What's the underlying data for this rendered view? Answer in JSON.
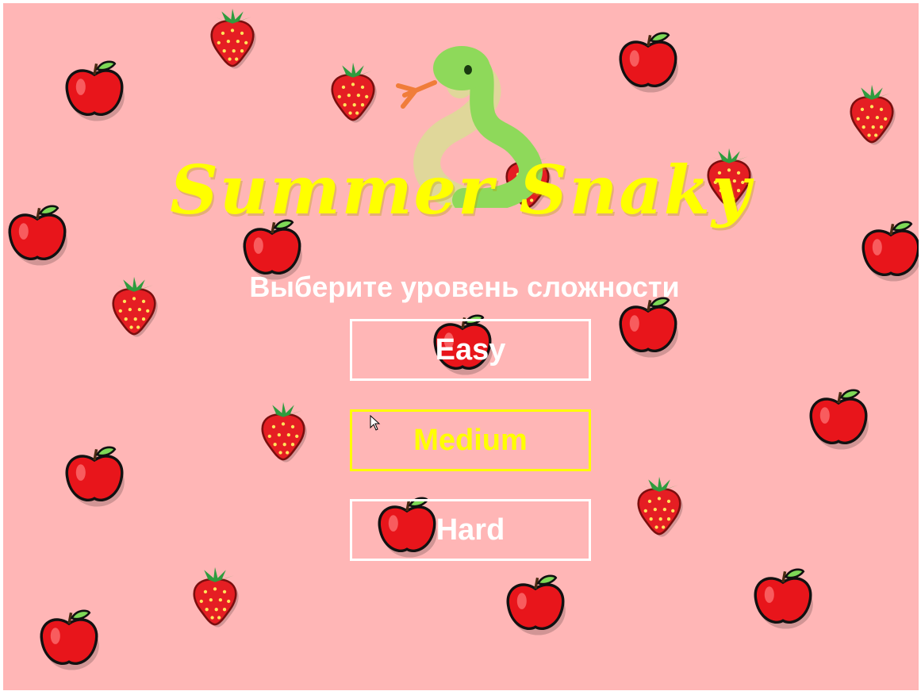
{
  "title": "Summer Snaky",
  "subtitle": "Выберите уровень сложности",
  "buttons": {
    "easy": "Easy",
    "medium": "Medium",
    "hard": "Hard"
  },
  "selected_level": "Medium",
  "colors": {
    "background": "#ffb6b6",
    "title": "#ffff00",
    "subtitle": "#ffffff",
    "button_border": "#ffffff",
    "button_text": "#ffffff",
    "selected": "#ffff00",
    "apple": "#e8151b",
    "strawberry": "#e51e23",
    "leaf": "#2e9c3e",
    "snake_body": "#8ed95a",
    "snake_belly": "#e0d79a",
    "snake_tongue": "#f07d3a"
  },
  "icons": {
    "fruit_apple": "apple-icon",
    "fruit_strawberry": "strawberry-icon",
    "mascot": "snake-icon",
    "pointer": "cursor-arrow-icon"
  }
}
